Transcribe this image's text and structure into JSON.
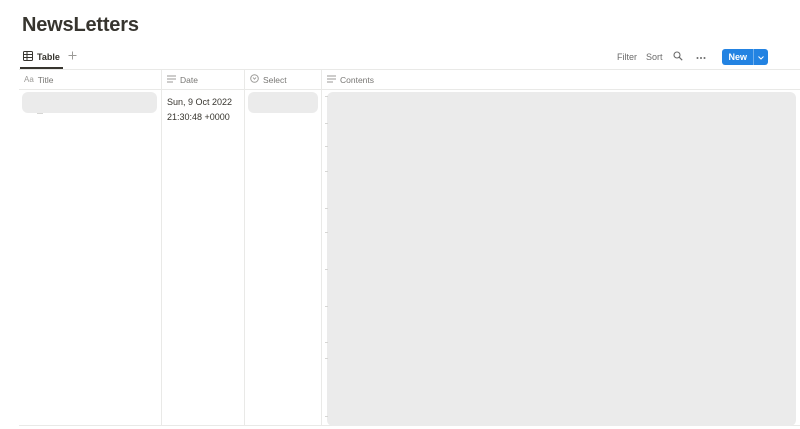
{
  "page": {
    "title": "NewsLetters"
  },
  "views": {
    "active_tab": "Table"
  },
  "toolbar": {
    "filter_label": "Filter",
    "sort_label": "Sort",
    "new_label": "New"
  },
  "table": {
    "columns": [
      {
        "name": "Title",
        "icon": "text-aa-icon"
      },
      {
        "name": "Date",
        "icon": "lines-icon"
      },
      {
        "name": "Select",
        "icon": "select-circle-icon"
      },
      {
        "name": "Contents",
        "icon": "lines-icon"
      }
    ],
    "rows": [
      {
        "date_line1": "Sun, 9 Oct 2022",
        "date_line2": "21:30:48 +0000"
      }
    ]
  },
  "colors": {
    "accent": "#2383e2",
    "text": "#37352f",
    "muted": "#787774",
    "border": "#e9e9e7",
    "redaction": "#ebebeb"
  }
}
